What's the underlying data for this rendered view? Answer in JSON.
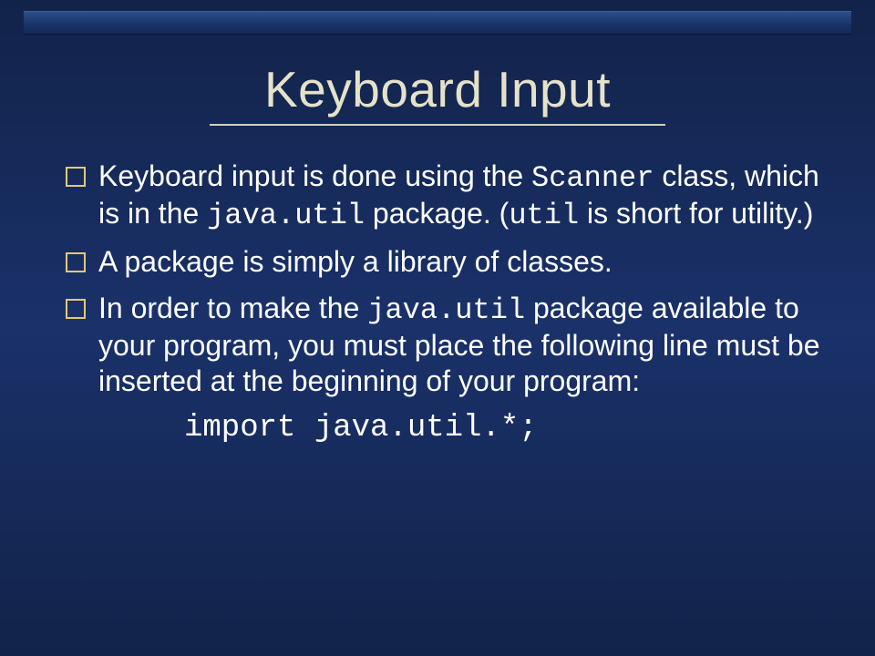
{
  "title": "Keyboard Input",
  "bullets": {
    "b1": {
      "t1": "Keyboard input is done using the ",
      "c1": "Scanner",
      "t2": " class, which is in the ",
      "c2": "java.util",
      "t3": " package. (",
      "c3": "util",
      "t4": " is short for utility.)"
    },
    "b2": "A package is simply a library of classes.",
    "b3": {
      "t1": "In order to make the ",
      "c1": "java.util",
      "t2": " package available to your program, you must place the following line must be inserted at the beginning of your program:"
    }
  },
  "code_line": "import java.util.*;"
}
